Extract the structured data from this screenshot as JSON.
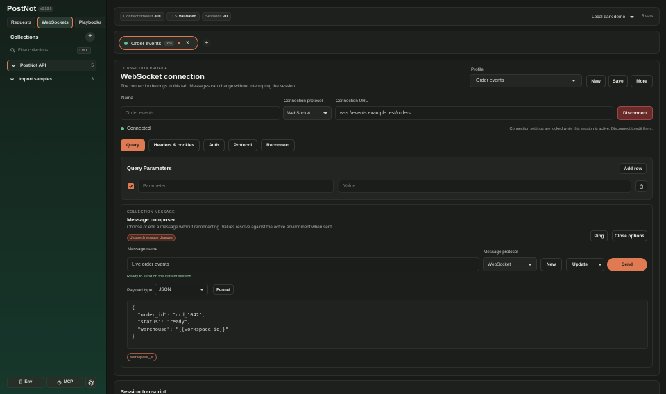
{
  "app": {
    "name": "PostNot",
    "version": "v0.28.0"
  },
  "sidebar": {
    "tabs": [
      {
        "label": "Requests"
      },
      {
        "label": "WebSockets"
      },
      {
        "label": "Playbooks"
      }
    ],
    "collections_title": "Collections",
    "filter_placeholder": "Filter collections",
    "filter_shortcut": "Ctrl K",
    "items": [
      {
        "label": "PostNot API",
        "count": "5"
      },
      {
        "label": "Import samples",
        "count": "3"
      }
    ],
    "bottom": {
      "env": "Env",
      "mcp": "MCP"
    }
  },
  "topbar": {
    "connect_timeout_label": "Connect timeout",
    "connect_timeout_value": "30s",
    "tls_label": "TLS",
    "tls_value": "Validated",
    "sessions_label": "Sessions",
    "sessions_value": "20",
    "environment": "Local dark demo",
    "vars": "5 vars"
  },
  "session_tab": {
    "label": "Order events",
    "badge": "WS",
    "close": "X",
    "add": "+"
  },
  "connection": {
    "eyebrow": "CONNECTION PROFILE",
    "title": "WebSocket connection",
    "description": "The connection belongs to this tab. Messages can change without interrupting the session.",
    "profile_label": "Profile",
    "profile_value": "Order events",
    "new": "New",
    "save": "Save",
    "more": "More",
    "name_label": "Name",
    "name_placeholder": "Order events",
    "protocol_label": "Connection protocol",
    "protocol_value": "WebSocket",
    "url_label": "Connection URL",
    "url_value": "wss://events.example.test/orders",
    "disconnect": "Disconnect",
    "status": "Connected",
    "lock_note": "Connection settings are locked while this session is active. Disconnect to edit them."
  },
  "subtabs": [
    {
      "label": "Query"
    },
    {
      "label": "Headers & cookies"
    },
    {
      "label": "Auth"
    },
    {
      "label": "Protocol"
    },
    {
      "label": "Reconnect"
    }
  ],
  "query": {
    "title": "Query Parameters",
    "add_row": "Add row",
    "param_placeholder": "Parameter",
    "value_placeholder": "Value"
  },
  "composer": {
    "eyebrow": "COLLECTION MESSAGE",
    "title": "Message composer",
    "description": "Choose or edit a message without reconnecting. Values resolve against the active environment when sent.",
    "unsaved": "Unsaved message changes",
    "ping": "Ping",
    "close_options": "Close options",
    "name_label": "Message name",
    "name_value": "Live order events",
    "protocol_label": "Message protocol",
    "protocol_value": "WebSocket",
    "new": "New",
    "update": "Update",
    "send": "Send",
    "ready_note": "Ready to send on the current session.",
    "payload_type_label": "Payload type",
    "payload_type_value": "JSON",
    "format": "Format",
    "payload_lines": [
      "{",
      "  \"order_id\": \"ord_1042\",",
      "  \"status\": \"ready\",",
      "  \"warehouse\": \"{{workspace_id}}\"",
      "}"
    ],
    "variable_tag": "workspace_id"
  },
  "transcript": {
    "title": "Session transcript"
  },
  "colors": {
    "accent": "#e07a52",
    "connected": "#5fc48e",
    "disconnect": "#6b2a2a"
  }
}
